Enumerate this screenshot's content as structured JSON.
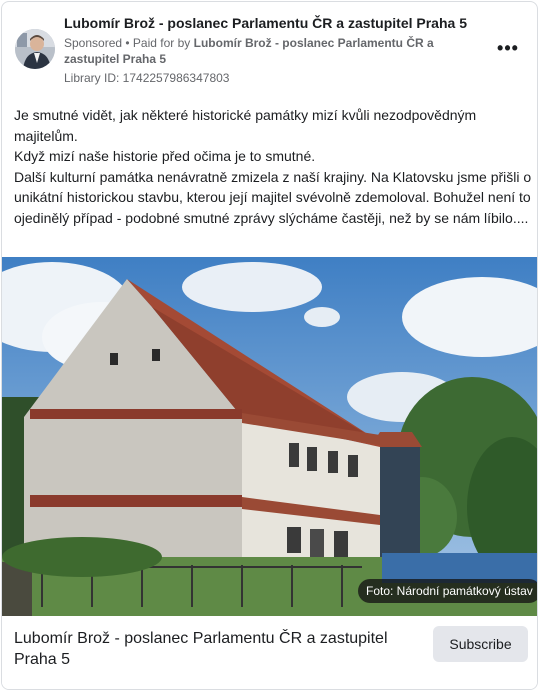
{
  "header": {
    "page_name": "Lubomír Brož - poslanec Parlamentu ČR a zastupitel Praha 5",
    "sponsored_label": "Sponsored",
    "separator": " • ",
    "paid_for_label": "Paid for by ",
    "paid_for_name": "Lubomír Brož - poslanec Parlamentu ČR a zastupitel Praha 5",
    "library_id": "Library ID: 1742257986347803",
    "more_label": "•••"
  },
  "post": {
    "lines": [
      "Je smutné vidět, jak některé historické památky mizí kvůli nezodpovědným majitelům.",
      "Když mizí naše historie před očima je to smutné.",
      "Další kulturní památka nenávratně zmizela z naší krajiny. Na Klatovsku jsme přišli o unikátní historickou stavbu, kterou její majitel svévolně zdemoloval. Bohužel není to ojedinělý případ - podobné smutné zprávy slýcháme častěji, než by se nám líbilo...."
    ]
  },
  "media": {
    "photo_credit": "Foto: Národní památkový ústav"
  },
  "footer": {
    "title": "Lubomír Brož - poslanec Parlamentu ČR a zastupitel Praha 5",
    "subscribe_label": "Subscribe"
  }
}
